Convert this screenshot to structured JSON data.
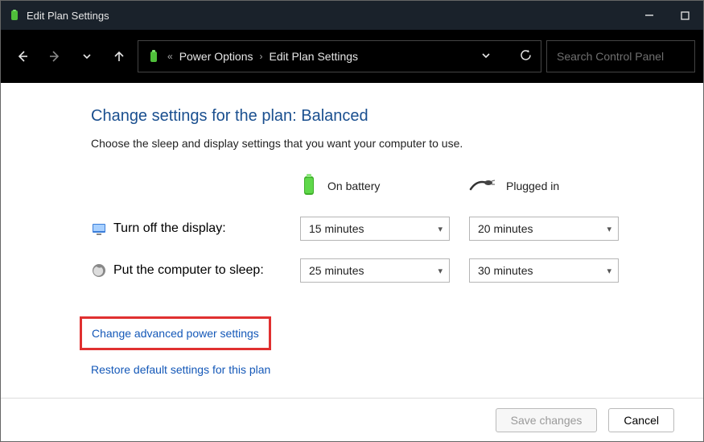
{
  "window": {
    "title": "Edit Plan Settings"
  },
  "breadcrumb": {
    "parent": "Power Options",
    "current": "Edit Plan Settings"
  },
  "search": {
    "placeholder": "Search Control Panel"
  },
  "page": {
    "heading": "Change settings for the plan: Balanced",
    "subtext": "Choose the sleep and display settings that you want your computer to use."
  },
  "columns": {
    "battery": "On battery",
    "plugged": "Plugged in"
  },
  "rows": {
    "display": {
      "label": "Turn off the display:",
      "battery": "15 minutes",
      "plugged": "20 minutes"
    },
    "sleep": {
      "label": "Put the computer to sleep:",
      "battery": "25 minutes",
      "plugged": "30 minutes"
    }
  },
  "links": {
    "advanced": "Change advanced power settings",
    "restore": "Restore default settings for this plan"
  },
  "buttons": {
    "save": "Save changes",
    "cancel": "Cancel"
  }
}
